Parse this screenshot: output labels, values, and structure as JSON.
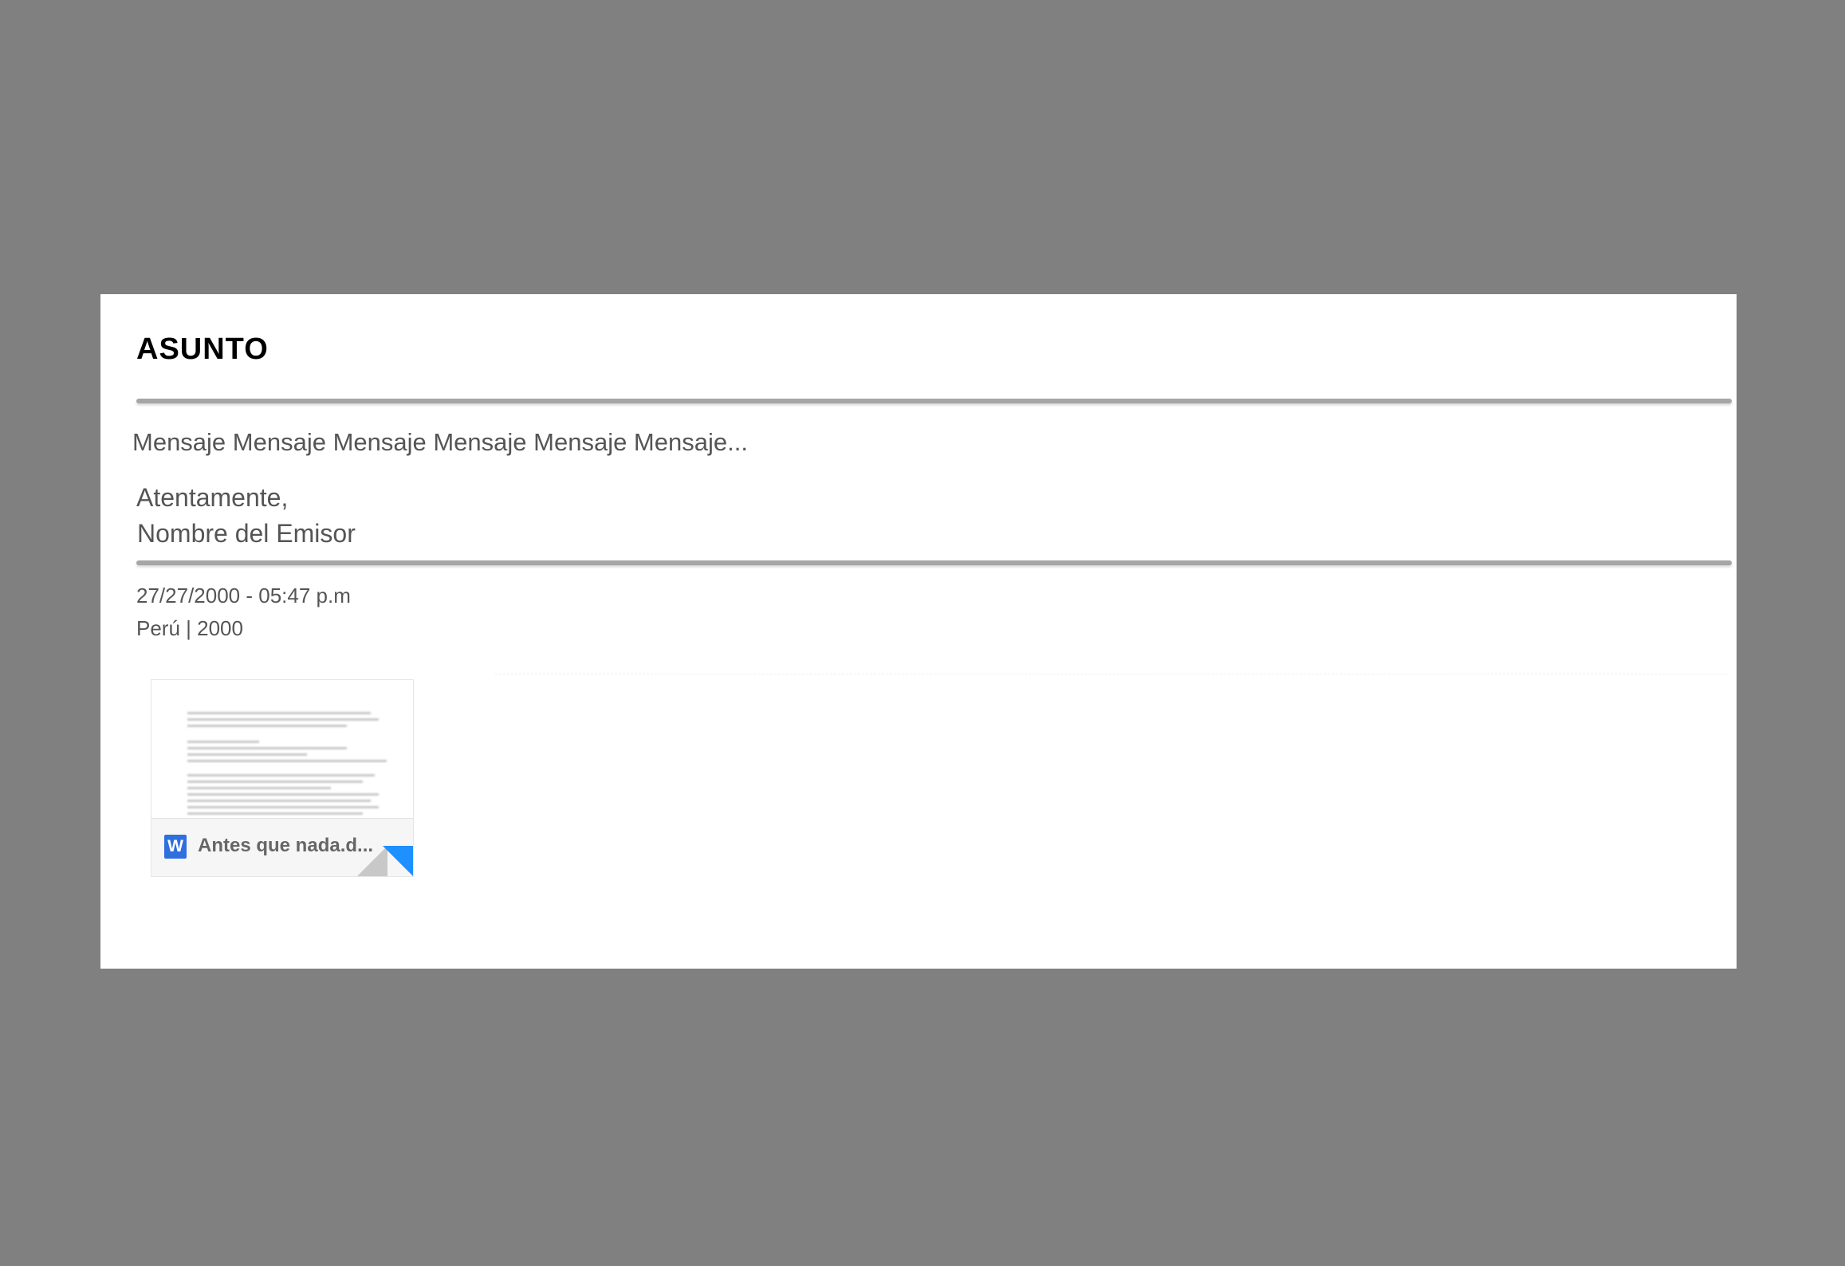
{
  "email": {
    "subject": "ASUNTO",
    "message": "Mensaje Mensaje Mensaje Mensaje Mensaje Mensaje...",
    "closing": "Atentamente,",
    "sender": "Nombre del Emisor",
    "datetime": "27/27/2000 - 05:47 p.m",
    "location": "Perú | 2000"
  },
  "attachment": {
    "name": "Antes que nada.d...",
    "icon": "word-doc-icon",
    "icon_letter": "W"
  },
  "colors": {
    "backdrop": "#808080",
    "card": "#ffffff",
    "divider": "#a6a6a6",
    "text": "#555555",
    "word_blue": "#2f6fde",
    "fold_blue": "#1e90ff"
  }
}
